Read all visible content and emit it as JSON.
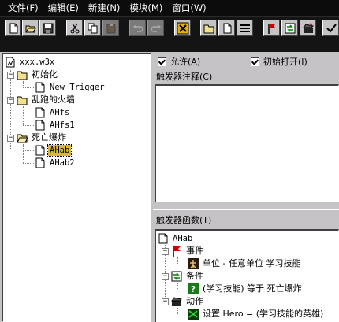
{
  "menu": [
    "文件(F)",
    "编辑(E)",
    "新建(N)",
    "模块(M)",
    "窗口(W)"
  ],
  "toolbar": {
    "buttons": [
      {
        "name": "new-map-icon",
        "disabled": false
      },
      {
        "name": "open-folder-icon",
        "disabled": false
      },
      {
        "name": "save-icon",
        "disabled": false
      },
      {
        "name": "cut-icon",
        "disabled": false
      },
      {
        "name": "copy-icon",
        "disabled": false
      },
      {
        "name": "paste-icon",
        "disabled": true
      },
      {
        "name": "undo-icon",
        "disabled": true
      },
      {
        "name": "redo-icon",
        "disabled": true
      },
      {
        "name": "delete-icon",
        "disabled": false
      },
      {
        "name": "new-category-icon",
        "disabled": false
      },
      {
        "name": "new-trigger-icon",
        "disabled": false
      },
      {
        "name": "new-comment-icon",
        "disabled": false
      },
      {
        "name": "new-event-icon",
        "disabled": false
      },
      {
        "name": "new-condition-icon",
        "disabled": false
      },
      {
        "name": "new-action-icon",
        "disabled": false
      },
      {
        "name": "test-map-icon",
        "disabled": false
      }
    ]
  },
  "tree": {
    "root": "xxx.w3x",
    "categories": [
      {
        "label": "初始化",
        "triggers": [
          "New Trigger"
        ]
      },
      {
        "label": "乱跑的火墙",
        "triggers": [
          "AHfs",
          "AHfs1"
        ]
      },
      {
        "label": "死亡爆炸",
        "triggers": [
          "AHab",
          "AHab2"
        ]
      }
    ],
    "selected": "AHab"
  },
  "trigger": {
    "enabled_label": "允许(A)",
    "initially_on_label": "初始打开(I)",
    "comment_label": "触发器注释(C)",
    "functions_label": "触发器函数(T)",
    "name": "AHab",
    "events_label": "事件",
    "event_text": "单位 - 任意单位 学习技能",
    "conditions_label": "条件",
    "condition_text": "(学习技能) 等于 死亡爆炸",
    "actions_label": "动作",
    "action_text": "设置 Hero = (学习技能的英雄)"
  },
  "colors": {
    "accent_selected": "#d8b838",
    "event_flag": "#d00000",
    "action_icon": "#008000"
  }
}
